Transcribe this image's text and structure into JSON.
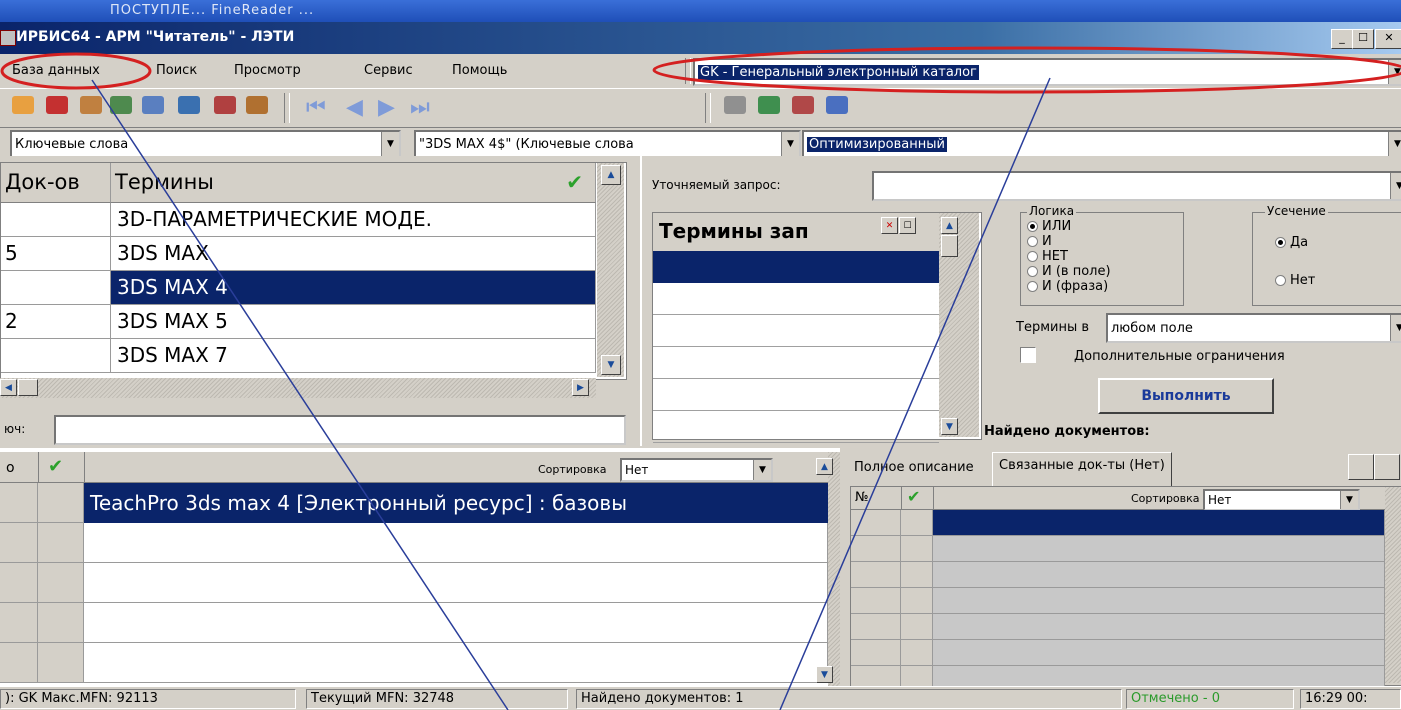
{
  "taskbar_text": "ПОСТУПЛЕ...   FineReader ...",
  "window": {
    "title": "ИРБИС64 - АРМ \"Читатель\" - ЛЭТИ"
  },
  "menu": [
    "База данных",
    "Поиск",
    "Просмотр",
    "Сервис",
    "Помощь"
  ],
  "database_select": {
    "value": "GK - Генеральный электронный каталог"
  },
  "search_bar": {
    "mode": "Ключевые слова",
    "term": "\"3DS MAX 4$\" (Ключевые слова",
    "method": "Оптимизированный"
  },
  "dictionary": {
    "headers": [
      "Док-ов",
      "Термины"
    ],
    "rows": [
      {
        "count": "",
        "term": "3D-ПАРАМЕТРИЧЕСКИЕ МОДЕ."
      },
      {
        "count": "5",
        "term": "3DS MAX"
      },
      {
        "count": "",
        "term": "3DS MAX 4"
      },
      {
        "count": "2",
        "term": "3DS MAX 5"
      },
      {
        "count": "",
        "term": "3DS MAX 7"
      }
    ],
    "key_label": "юч:"
  },
  "query": {
    "refine_label": "Уточняемый запрос:",
    "terms_header": "Термины зап",
    "logic": {
      "label": "Логика",
      "options": [
        "ИЛИ",
        "И",
        "НЕТ",
        "И (в поле)",
        "И (фраза)"
      ],
      "selected": 0
    },
    "truncation": {
      "label": "Усечение",
      "options": [
        "Да",
        "Нет"
      ],
      "selected": 0
    },
    "terms_in_label": "Термины в",
    "terms_in_value": "любом поле",
    "extra_label": "Дополнительные ограничения",
    "execute_label": "Выполнить",
    "found_label": "Найдено документов:"
  },
  "results": {
    "col_num": "о",
    "sort_label": "Сортировка",
    "sort_value": "Нет",
    "first_row": "TeachPro 3ds max 4 [Электронный ресурс] : базовы"
  },
  "right_panel": {
    "tabs": [
      "Полное описание",
      "Связанные док-ты (Нет)"
    ],
    "col_num": "№",
    "sort_label": "Сортировка",
    "sort_value": "Нет"
  },
  "status": {
    "db_max": "): GK Макс.MFN: 92113",
    "current": "Текущий MFN: 32748",
    "found": "Найдено документов: 1",
    "marked": "Отмечено - 0",
    "time": "16:29  00:"
  },
  "colors": {
    "title_bar": "#0a246a",
    "selection": "#0a246a",
    "annotation_red": "#d42020",
    "annotation_line": "#2a3e9a"
  }
}
